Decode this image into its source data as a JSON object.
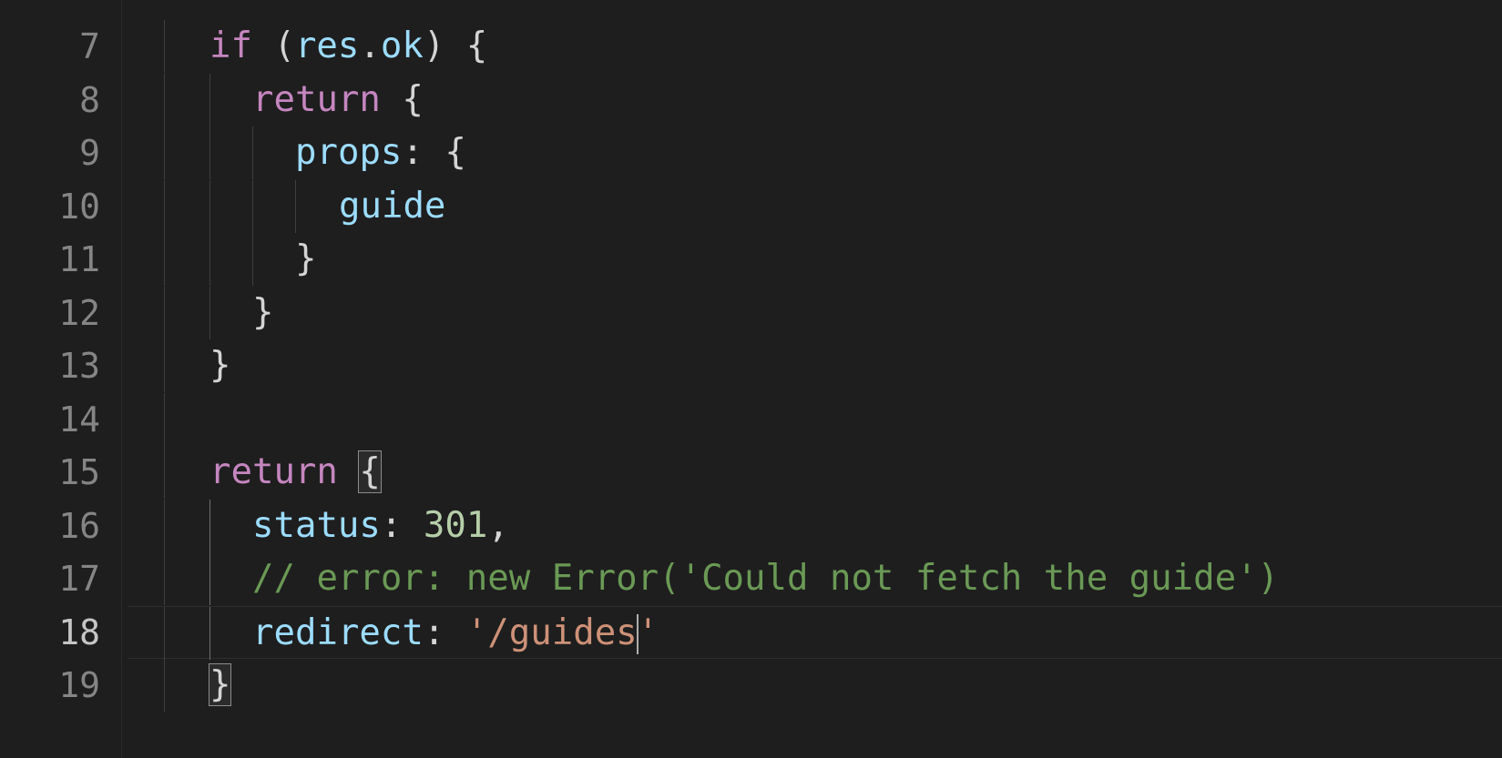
{
  "editor": {
    "lines": [
      {
        "number": "7",
        "tokens": [
          {
            "t": "if",
            "c": "kw"
          },
          {
            "t": " (",
            "c": "plain"
          },
          {
            "t": "res",
            "c": "var"
          },
          {
            "t": ".",
            "c": "plain"
          },
          {
            "t": "ok",
            "c": "var"
          },
          {
            "t": ") {",
            "c": "plain"
          }
        ]
      },
      {
        "number": "8",
        "tokens": [
          {
            "t": "return",
            "c": "kw"
          },
          {
            "t": " {",
            "c": "plain"
          }
        ]
      },
      {
        "number": "9",
        "tokens": [
          {
            "t": "props",
            "c": "var"
          },
          {
            "t": ": {",
            "c": "plain"
          }
        ]
      },
      {
        "number": "10",
        "tokens": [
          {
            "t": "guide",
            "c": "var"
          }
        ]
      },
      {
        "number": "11",
        "tokens": [
          {
            "t": "}",
            "c": "plain"
          }
        ]
      },
      {
        "number": "12",
        "tokens": [
          {
            "t": "}",
            "c": "plain"
          }
        ]
      },
      {
        "number": "13",
        "tokens": [
          {
            "t": "}",
            "c": "plain"
          }
        ]
      },
      {
        "number": "14",
        "tokens": []
      },
      {
        "number": "15",
        "tokens": [
          {
            "t": "return",
            "c": "kw"
          },
          {
            "t": " ",
            "c": "plain"
          },
          {
            "t": "{",
            "c": "plain",
            "match": true
          }
        ]
      },
      {
        "number": "16",
        "tokens": [
          {
            "t": "status",
            "c": "var"
          },
          {
            "t": ": ",
            "c": "plain"
          },
          {
            "t": "301",
            "c": "num"
          },
          {
            "t": ",",
            "c": "plain"
          }
        ]
      },
      {
        "number": "17",
        "tokens": [
          {
            "t": "// error: new Error('Could not fetch the guide')",
            "c": "cmt"
          }
        ]
      },
      {
        "number": "18",
        "current": true,
        "tokens": [
          {
            "t": "redirect",
            "c": "var"
          },
          {
            "t": ": ",
            "c": "plain"
          },
          {
            "t": "'/guides",
            "c": "str"
          },
          {
            "cursor": true
          },
          {
            "t": "'",
            "c": "str"
          }
        ]
      },
      {
        "number": "19",
        "tokens": [
          {
            "t": "}",
            "c": "plain",
            "match": true
          }
        ]
      }
    ]
  }
}
